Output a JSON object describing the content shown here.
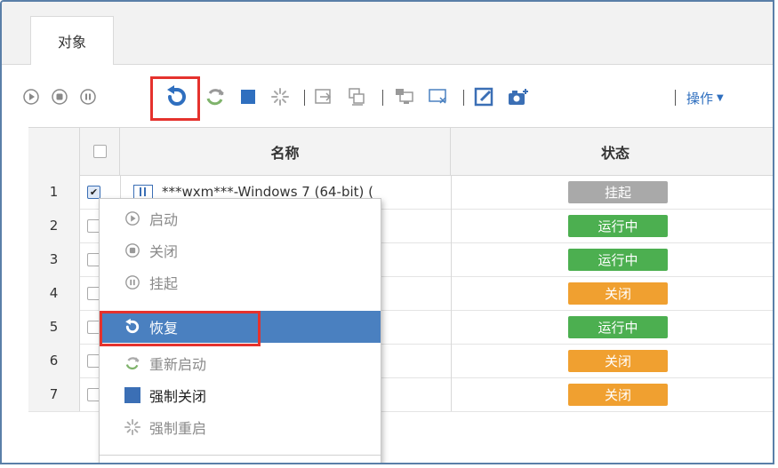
{
  "tab": {
    "label": "对象"
  },
  "toolbar": {
    "icons": [
      "play-circle-icon",
      "stop-circle-icon",
      "pause-circle-icon",
      "resume-undo-icon",
      "restart-icon",
      "force-stop-icon",
      "force-restart-icon",
      "migrate-icon",
      "clone-icon",
      "console-icon",
      "snapshot-icon",
      "edit-icon",
      "camera-icon"
    ],
    "ops_label": "操作"
  },
  "table": {
    "headers": {
      "name": "名称",
      "status": "状态"
    },
    "rows": [
      {
        "num": "1",
        "checked": true,
        "name": "***wxm***-Windows 7 (64-bit) (",
        "status": "挂起",
        "status_color": "#a9a9a9"
      },
      {
        "num": "2",
        "checked": false,
        "name": "",
        "status": "运行中",
        "status_color": "#4caf50"
      },
      {
        "num": "3",
        "checked": false,
        "name": "",
        "status": "运行中",
        "status_color": "#4caf50"
      },
      {
        "num": "4",
        "checked": false,
        "name": "",
        "status": "关闭",
        "status_color": "#f0a030"
      },
      {
        "num": "5",
        "checked": false,
        "name": "",
        "status": "运行中",
        "status_color": "#4caf50"
      },
      {
        "num": "6",
        "checked": false,
        "name": "",
        "status": "关闭",
        "status_color": "#f0a030"
      },
      {
        "num": "7",
        "checked": false,
        "name": "",
        "status": "关闭",
        "status_color": "#f0a030"
      }
    ]
  },
  "context_menu": {
    "items": [
      {
        "label": "启动",
        "icon": "play-circle-icon",
        "state": "disabled"
      },
      {
        "label": "关闭",
        "icon": "stop-circle-icon",
        "state": "disabled"
      },
      {
        "label": "挂起",
        "icon": "pause-circle-icon",
        "state": "disabled"
      },
      {
        "label": "恢复",
        "icon": "resume-undo-icon",
        "state": "active"
      },
      {
        "label": "重新启动",
        "icon": "restart-icon",
        "state": "disabled"
      },
      {
        "label": "强制关闭",
        "icon": "force-stop-icon",
        "state": "enabled"
      },
      {
        "label": "强制重启",
        "icon": "force-restart-icon",
        "state": "disabled"
      }
    ]
  },
  "colors": {
    "accent": "#2f6fbf",
    "highlight_border": "#e5322d",
    "menu_active": "#4a80c0"
  }
}
